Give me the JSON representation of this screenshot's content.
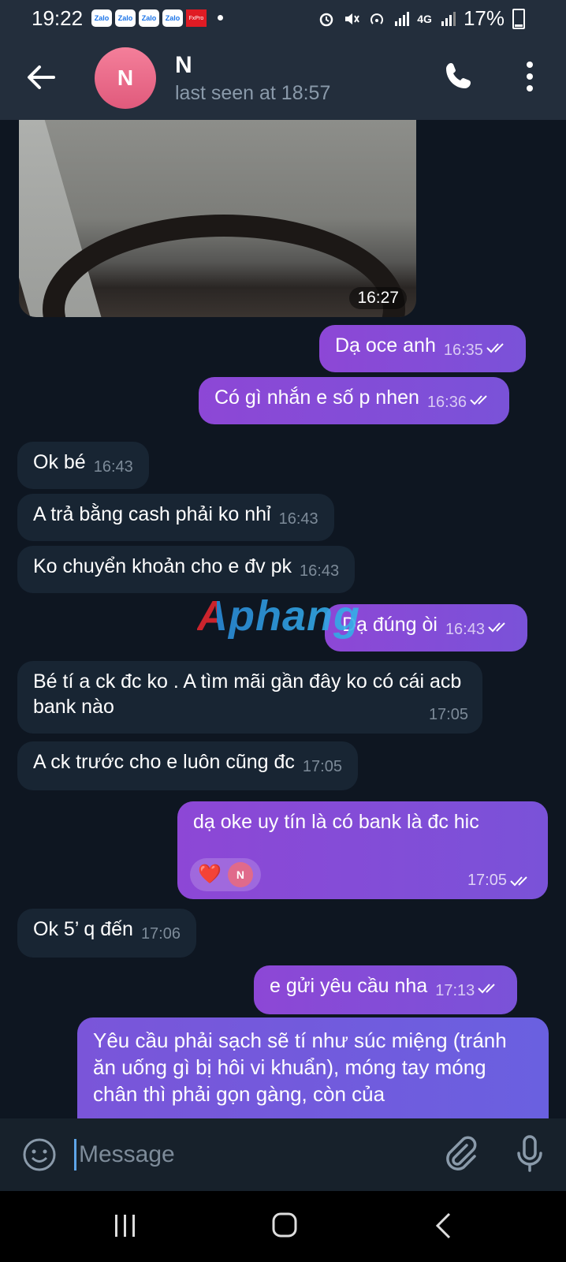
{
  "status_bar": {
    "time": "19:22",
    "notif_labels": [
      "Zalo",
      "Zalo",
      "Zalo",
      "Zalo",
      "FxPro"
    ],
    "battery": "17%",
    "network": "4G"
  },
  "header": {
    "avatar_initial": "N",
    "name": "N",
    "status": "last seen at 18:57"
  },
  "photo": {
    "time": "16:27"
  },
  "messages": [
    {
      "text": "Dạ oce anh",
      "time": "16:35",
      "dir": "out"
    },
    {
      "text": "Có gì nhắn e số p nhen",
      "time": "16:36",
      "dir": "out"
    },
    {
      "text": "Ok bé",
      "time": "16:43",
      "dir": "in"
    },
    {
      "text": "A trả bằng cash phải ko nhỉ",
      "time": "16:43",
      "dir": "in"
    },
    {
      "text": "Ko chuyển khoản cho e đv pk",
      "time": "16:43",
      "dir": "in"
    },
    {
      "text": "Dạ đúng òi",
      "time": "16:43",
      "dir": "out"
    },
    {
      "text": "Bé tí a ck đc ko . A tìm mãi gần đây ko có cái acb bank nào",
      "time": "17:05",
      "dir": "in"
    },
    {
      "text": "A ck trước cho e luôn cũng đc",
      "time": "17:05",
      "dir": "in"
    },
    {
      "text": "dạ oke uy tín là có bank là đc hic",
      "time": "17:05",
      "dir": "out",
      "reaction": "❤️",
      "reaction_avatar": "N"
    },
    {
      "text": "Ok 5’ q đến",
      "time": "17:06",
      "dir": "in"
    },
    {
      "text": "e gửi yêu cầu nha",
      "time": "17:13",
      "dir": "out"
    },
    {
      "text": "Yêu cầu phải sạch sẽ tí như súc miệng (tránh ăn uống gì bị hôi vi khuẩn), móng tay móng chân thì phải gọn gàng, còn của",
      "time": "",
      "dir": "out"
    }
  ],
  "watermark": "Aphang",
  "input": {
    "placeholder": "Message"
  },
  "colors": {
    "header_bg": "#232e3c",
    "chat_bg": "#0e1621",
    "incoming_bubble": "#182533",
    "outgoing_bubble": "#8d47d6"
  }
}
